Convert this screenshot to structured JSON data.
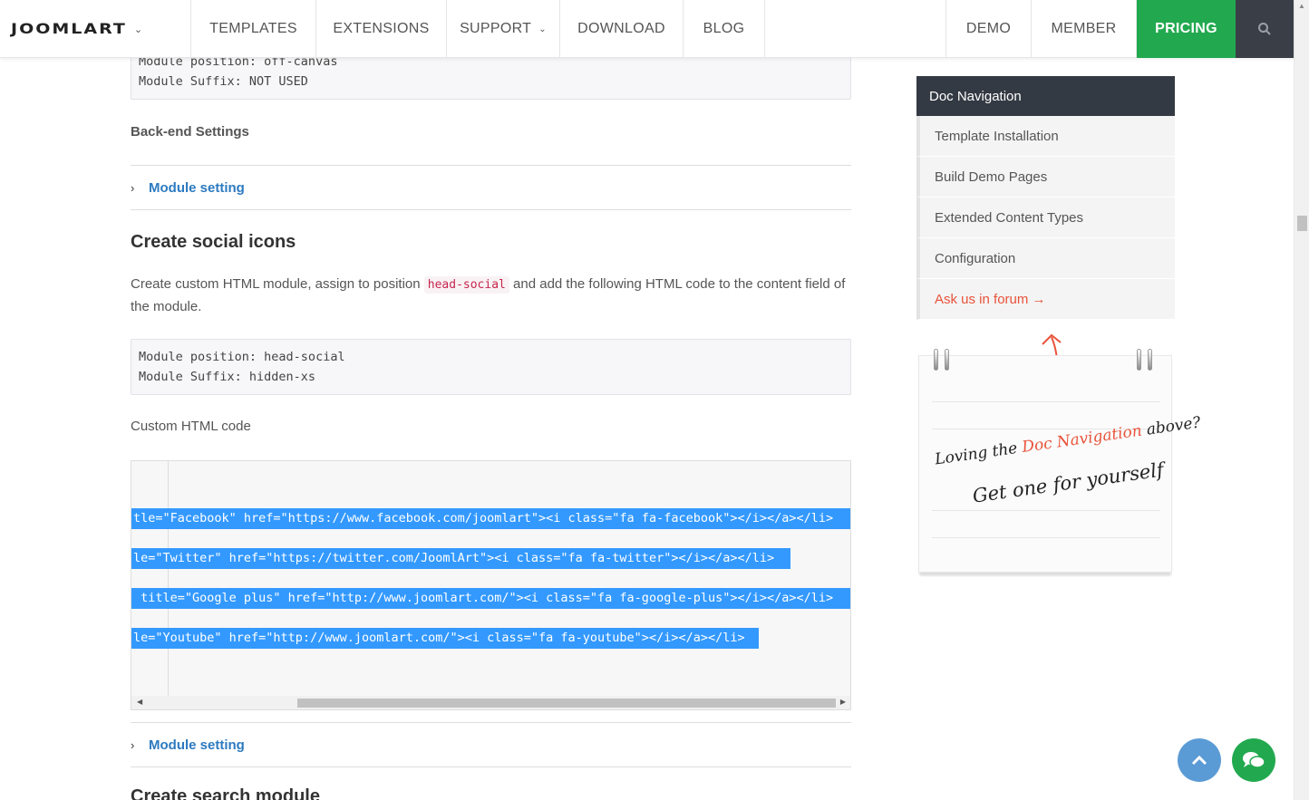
{
  "header": {
    "logo": "JOOMLART",
    "nav": [
      {
        "label": "TEMPLATES"
      },
      {
        "label": "EXTENSIONS"
      },
      {
        "label": "SUPPORT"
      },
      {
        "label": "DOWNLOAD"
      },
      {
        "label": "BLOG"
      }
    ],
    "nav_right": [
      {
        "label": "DEMO"
      },
      {
        "label": "MEMBER"
      },
      {
        "label": "PRICING"
      }
    ],
    "search_icon": "search-icon"
  },
  "main": {
    "top_code": [
      "Module position: off-canvas",
      "Module Suffix: NOT USED"
    ],
    "backend_heading": "Back-end Settings",
    "accordion_1": "Module setting",
    "social_heading": "Create social icons",
    "para_before": "Create custom HTML module, assign to position ",
    "para_code": "head-social",
    "para_after": " and add the following HTML code to the content field of the module.",
    "mid_code": [
      "Module position: head-social",
      "Module Suffix: hidden-xs"
    ],
    "custom_label": "Custom HTML code",
    "code_lines": [
      "tle=\"Facebook\" href=\"https://www.facebook.com/joomlart\"><i class=\"fa fa-facebook\"></i></a></li>",
      "le=\"Twitter\" href=\"https://twitter.com/JoomlArt\"><i class=\"fa fa-twitter\"></i></a></li>",
      " title=\"Google plus\" href=\"http://www.joomlart.com/\"><i class=\"fa fa-google-plus\"></i></a></li>",
      "le=\"Youtube\" href=\"http://www.joomlart.com/\"><i class=\"fa fa-youtube\"></i></a></li>"
    ],
    "accordion_2": "Module setting",
    "search_heading": "Create search module"
  },
  "sidebar": {
    "title": "Doc Navigation",
    "items": [
      {
        "label": "Template Installation"
      },
      {
        "label": "Build Demo Pages"
      },
      {
        "label": "Extended Content Types"
      },
      {
        "label": "Configuration"
      }
    ],
    "forum": "Ask us in forum →",
    "note_line1_a": "Loving the ",
    "note_line1_b": "Doc Navigation",
    "note_line1_c": " above?",
    "note_line2": "Get one for yourself"
  },
  "colors": {
    "accent": "#22a94f",
    "link": "#2d7ac0",
    "dark": "#343a43",
    "forum": "#e8533a",
    "selection": "#3399ff"
  }
}
